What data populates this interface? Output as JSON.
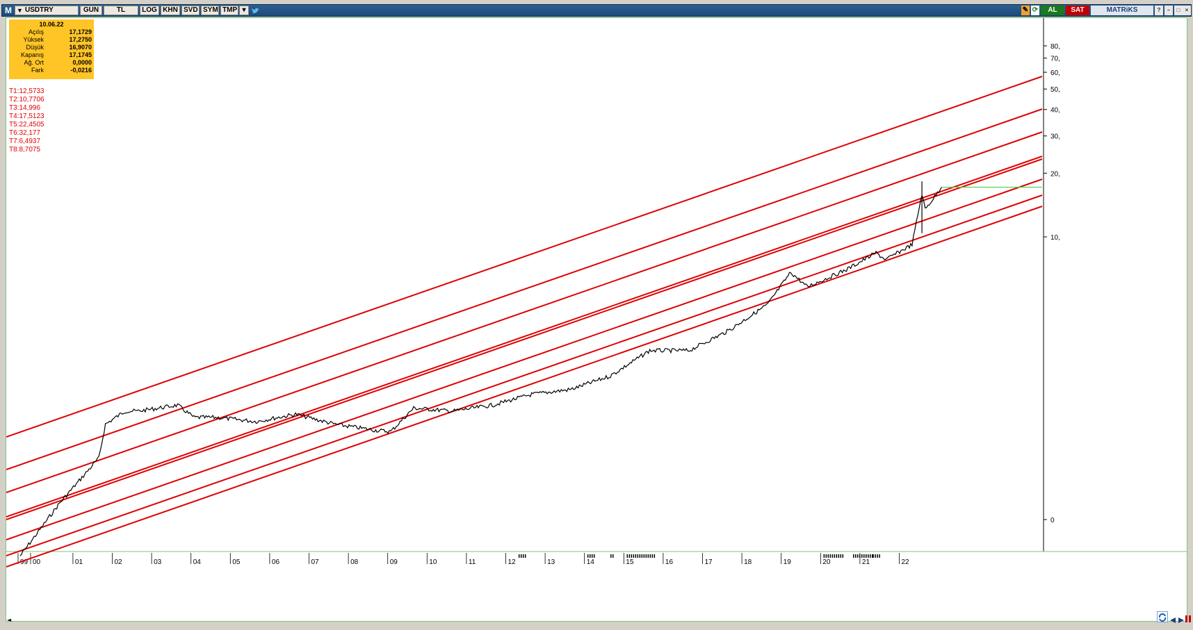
{
  "toolbar": {
    "logo": "M",
    "symbol": "USDTRY",
    "buttons": [
      "GUN",
      "TL",
      "LOG",
      "KHN",
      "SVD",
      "SYM",
      "TMP"
    ],
    "buy_label": "AL",
    "sell_label": "SAT",
    "brand": "MATRiKS",
    "buy_color": "#1b7a1b",
    "sell_color": "#c00000"
  },
  "info": {
    "date": "10.06.22",
    "rows": [
      {
        "label": "Açılış",
        "value": "17,1729"
      },
      {
        "label": "Yüksek",
        "value": "17,2750"
      },
      {
        "label": "Düşük",
        "value": "16,9070"
      },
      {
        "label": "Kapanış",
        "value": "17,1745"
      },
      {
        "label": "Ağ. Ort",
        "value": "0,0000"
      },
      {
        "label": "Fark",
        "value": "-0,0216"
      }
    ],
    "box_color": "#ffc526"
  },
  "targets": [
    "T1:12,5733",
    "T2:10,7706",
    "T3:14,996",
    "T4:17,5123",
    "T5:22,4505",
    "T6:32,177",
    "T7:6,4937",
    "T8:8,7075"
  ],
  "chart_data": {
    "type": "line",
    "title": "",
    "y_scale": "log",
    "y_ticks": [
      "80,",
      "70,",
      "60,",
      "50,",
      "40,",
      "30,",
      "20,",
      "10,",
      "0"
    ],
    "x_ticks": [
      "99",
      "00",
      "01",
      "02",
      "03",
      "04",
      "05",
      "06",
      "07",
      "08",
      "09",
      "10",
      "11",
      "12",
      "13",
      "14",
      "15",
      "16",
      "17",
      "18",
      "19",
      "20",
      "21",
      "22"
    ],
    "last_close": 17.1745,
    "horizontal_line": {
      "value": 17.17,
      "color": "#55d355"
    },
    "channel_lines_color": "#e00000",
    "price_color": "#000000",
    "price_series": [
      [
        "1999",
        0.31
      ],
      [
        "2000",
        0.55
      ],
      [
        "2001",
        0.9
      ],
      [
        "2001-03",
        1.3
      ],
      [
        "2001-09",
        1.5
      ],
      [
        "2002",
        1.5
      ],
      [
        "2003",
        1.6
      ],
      [
        "2003-06",
        1.4
      ],
      [
        "2004",
        1.4
      ],
      [
        "2005",
        1.34
      ],
      [
        "2006",
        1.45
      ],
      [
        "2007",
        1.3
      ],
      [
        "2008",
        1.22
      ],
      [
        "2008-06",
        1.2
      ],
      [
        "2009",
        1.55
      ],
      [
        "2010",
        1.5
      ],
      [
        "2011",
        1.6
      ],
      [
        "2012",
        1.8
      ],
      [
        "2013",
        1.9
      ],
      [
        "2014",
        2.2
      ],
      [
        "2015",
        2.9
      ],
      [
        "2016",
        2.9
      ],
      [
        "2017",
        3.6
      ],
      [
        "2018",
        4.8
      ],
      [
        "2018-08",
        6.8
      ],
      [
        "2019",
        5.8
      ],
      [
        "2020",
        7.0
      ],
      [
        "2020-10",
        8.4
      ],
      [
        "2021",
        7.8
      ],
      [
        "2021-09",
        9.2
      ],
      [
        "2021-12",
        16.0
      ],
      [
        "2022",
        13.5
      ],
      [
        "2022-06",
        17.17
      ]
    ]
  },
  "bottom": {
    "scroll_left": "◄",
    "icons": [
      "refresh-icon",
      "play-back-icon",
      "play-icon",
      "pause-icon"
    ]
  }
}
